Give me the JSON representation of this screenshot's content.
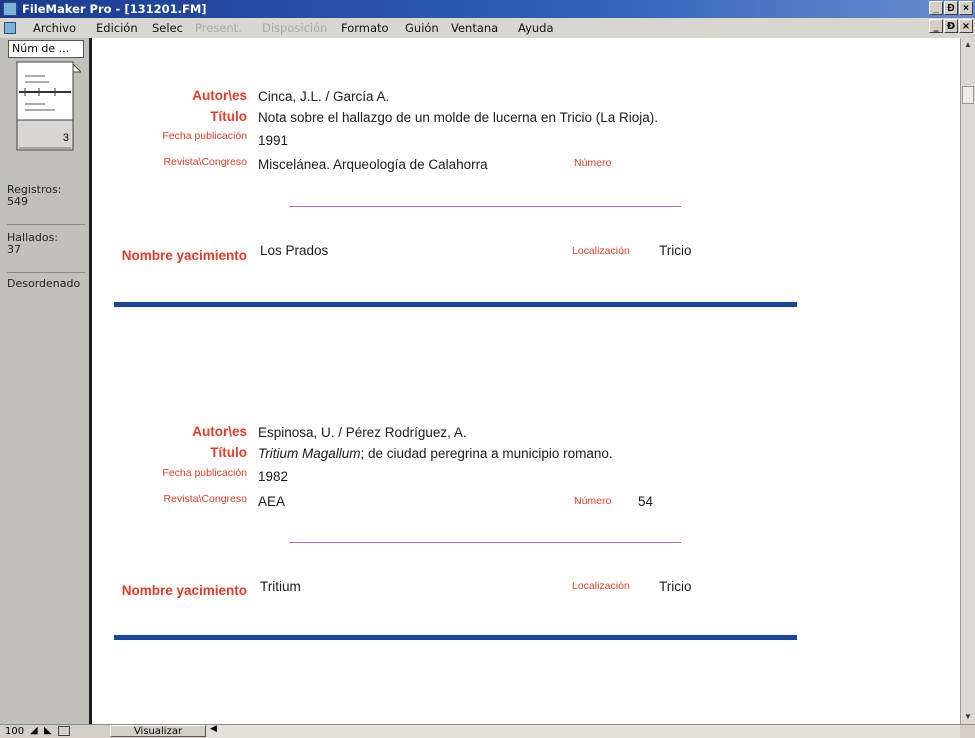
{
  "window": {
    "title": "FileMaker Pro - [131201.FM]"
  },
  "window_buttons": {
    "minimize": "_",
    "restore": "Ɖ",
    "close": "×"
  },
  "menu": [
    {
      "label": "Archivo",
      "enabled": true
    },
    {
      "label": "Edición",
      "enabled": true
    },
    {
      "label": "Selec",
      "enabled": true
    },
    {
      "label": "Present.",
      "enabled": false
    },
    {
      "label": "Disposición",
      "enabled": false
    },
    {
      "label": "Formato",
      "enabled": true
    },
    {
      "label": "Guión",
      "enabled": true
    },
    {
      "label": "Ventana",
      "enabled": true
    },
    {
      "label": "Ayuda",
      "enabled": true
    }
  ],
  "sidebar": {
    "layout_select": "Núm de ...",
    "book_page": "3",
    "registros_label": "Registros:",
    "registros_value": "549",
    "hallados_label": "Hallados:",
    "hallados_value": "37",
    "sort_status": "Desordenado"
  },
  "labels": {
    "autores": "Autor\\es",
    "titulo": "Título",
    "fecha": "Fecha publicación",
    "revista": "Revista\\Congreso",
    "numero": "Número",
    "yacimiento": "Nombre yacimiento",
    "localizacion": "Localización"
  },
  "records": [
    {
      "autores": "Cinca, J.L. / García A.",
      "titulo": "Nota sobre el hallazgo de un molde de lucerna en Tricio (La Rioja).",
      "titulo_italic": "",
      "fecha": "1991",
      "revista": "Miscelánea. Arqueología de Calahorra",
      "numero": "",
      "yacimiento": "Los Prados",
      "localizacion": "Tricio"
    },
    {
      "autores": "Espinosa, U. / Pérez Rodríguez, A.",
      "titulo": "; de ciudad peregrina a municipio romano.",
      "titulo_italic": "Tritium Magallum",
      "fecha": "1982",
      "revista": "AEA",
      "numero": "54",
      "yacimiento": "Tritium",
      "localizacion": "Tricio"
    }
  ],
  "statusbar": {
    "zoom": "100",
    "mode": "Visualizar"
  },
  "colors": {
    "label_red": "#e23b2a",
    "divider_purple": "#b06ab0",
    "record_blue": "#1846a0",
    "titlebar": "#1b3a8f"
  }
}
